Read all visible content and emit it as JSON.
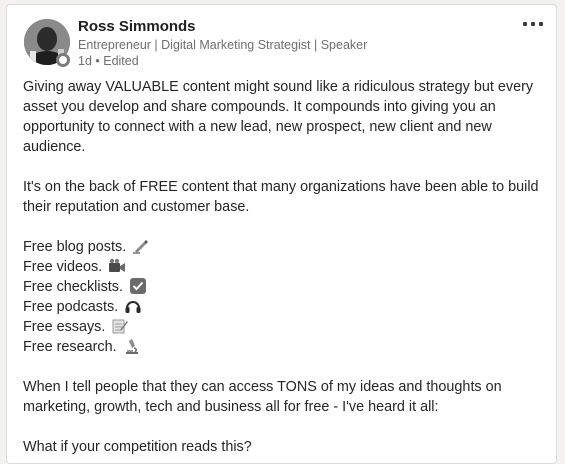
{
  "author": {
    "name": "Ross Simmonds",
    "headline": "Entrepreneur | Digital Marketing Strategist | Speaker",
    "meta": "1d • Edited"
  },
  "post": {
    "paragraph1": "Giving away VALUABLE content might sound like a ridiculous strategy but every asset you develop and share compounds. It compounds into giving you an opportunity to connect with a new lead, new prospect, new client and new audience.",
    "paragraph2": "It's on the back of FREE content that many organizations have been able to build their reputation and customer base.",
    "free_list": [
      {
        "text": "Free blog posts.",
        "icon": "writing-hand-icon"
      },
      {
        "text": "Free videos.",
        "icon": "video-camera-icon"
      },
      {
        "text": "Free checklists.",
        "icon": "check-box-icon"
      },
      {
        "text": "Free podcasts.",
        "icon": "headphones-icon"
      },
      {
        "text": "Free essays.",
        "icon": "memo-icon"
      },
      {
        "text": "Free research.",
        "icon": "microscope-icon"
      }
    ],
    "paragraph3": "When I tell people that they can access TONS of my ideas and thoughts on marketing, growth, tech and business all for free - I've heard it all:",
    "paragraph4": "What if your competition reads this?"
  }
}
